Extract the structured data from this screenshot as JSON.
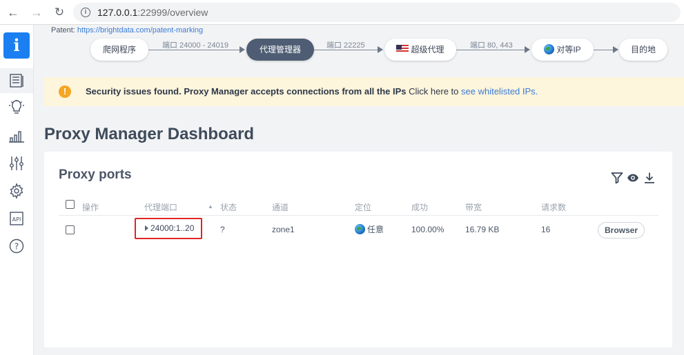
{
  "browser": {
    "url_host": "127.0.0.1",
    "url_rest": ":22999/overview"
  },
  "sidebar": {
    "items": [
      {
        "name": "logo",
        "label": "i"
      },
      {
        "name": "overview-icon"
      },
      {
        "name": "lightbulb-icon"
      },
      {
        "name": "stats-icon"
      },
      {
        "name": "sliders-icon"
      },
      {
        "name": "gear-icon"
      },
      {
        "name": "api-icon",
        "label": "API"
      },
      {
        "name": "help-icon",
        "label": "?"
      }
    ]
  },
  "flow": {
    "patent_prefix": "Patent:",
    "patent_link": "https://brightdata.com/patent-marking",
    "nodes": [
      "爬网程序",
      "代理管理器",
      "超级代理",
      "对等IP",
      "目的地"
    ],
    "links": [
      "端口 24000 - 24019",
      "端口 22225",
      "端口 80, 443"
    ]
  },
  "warning": {
    "icon": "!",
    "bold": "Security issues found. Proxy Manager accepts connections from all the IPs",
    "plain": " Click here to ",
    "link": "see whitelisted IPs."
  },
  "page": {
    "title": "Proxy Manager Dashboard"
  },
  "card": {
    "title": "Proxy ports",
    "tools": [
      "filter-icon",
      "eye-icon",
      "download-icon"
    ],
    "headers": [
      "操作",
      "代理端口",
      "状态",
      "通道",
      "定位",
      "成功",
      "带宽",
      "请求数"
    ],
    "rows": [
      {
        "port": "24000:1..20",
        "status": "?",
        "zone": "zone1",
        "location": "任意",
        "success": "100.00%",
        "bandwidth": "16.79 KB",
        "requests": "16",
        "action": "Browser"
      }
    ]
  },
  "colors": {
    "accent": "#1b7ff2",
    "active_node": "#4e5d73",
    "warning_bg": "#fdf5dc",
    "warning_icon": "#f5a623",
    "highlight_border": "#e02424",
    "link": "#3a7bd5"
  }
}
